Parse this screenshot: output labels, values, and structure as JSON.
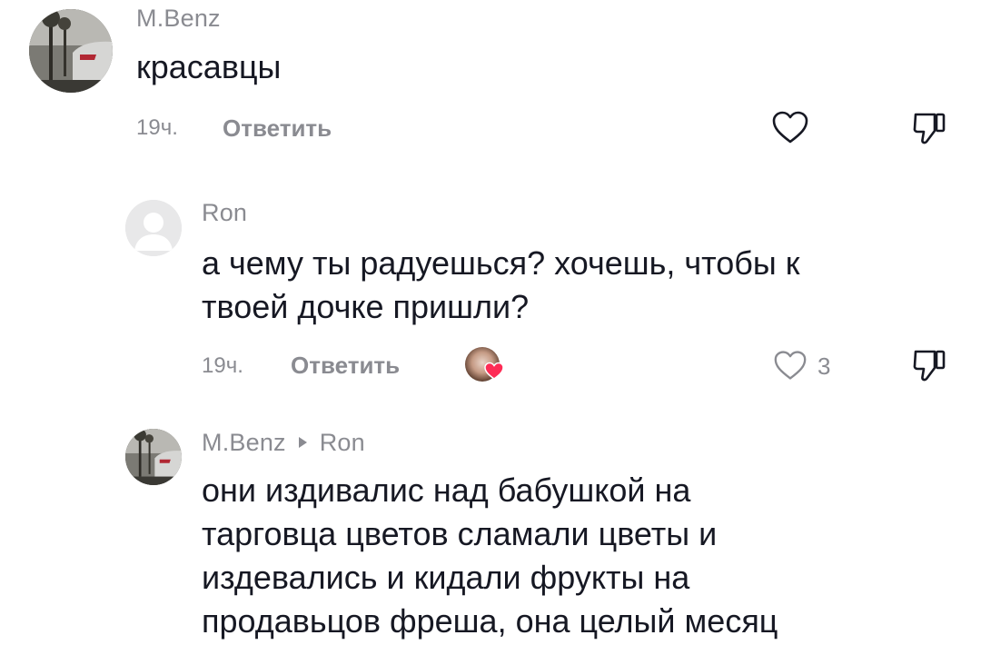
{
  "comments": [
    {
      "username": "M.Benz",
      "text": "красавцы",
      "time": "19ч.",
      "reply_label": "Ответить",
      "like_count": ""
    },
    {
      "username": "Ron",
      "text": "а чему ты радуешься? хочешь, чтобы к\nтвоей дочке пришли?",
      "time": "19ч.",
      "reply_label": "Ответить",
      "like_count": "3"
    },
    {
      "username": "M.Benz",
      "reply_to": "Ron",
      "text": "они издивалис над бабушкой на\nтарговца цветов сламали цветы и\nиздевались и кидали фрукты на\nпродавьцов фреша, она целый месяц"
    }
  ],
  "colors": {
    "text": "#161823",
    "secondary": "#8a8b91",
    "creator_heart": "#fe2c55"
  }
}
